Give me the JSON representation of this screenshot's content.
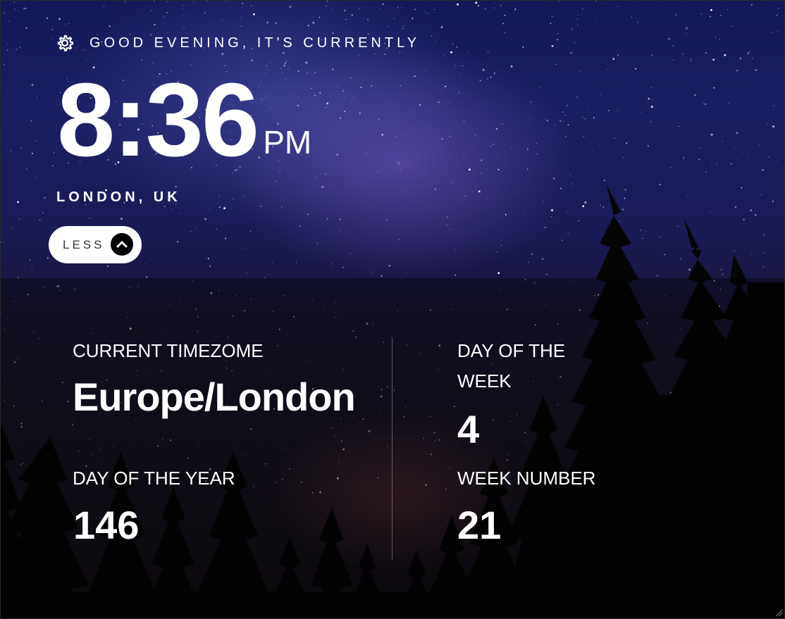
{
  "header": {
    "greeting": "GOOD EVENING, IT'S CURRENTLY",
    "settings_icon": "gear-icon"
  },
  "clock": {
    "time": "8:36",
    "period": "PM",
    "location": "LONDON, UK"
  },
  "toggle": {
    "label": "LESS",
    "icon": "chevron-up-icon"
  },
  "details": {
    "timezone": {
      "label": "CURRENT TIMEZOME",
      "value": "Europe/London"
    },
    "day_of_year": {
      "label": "DAY OF THE YEAR",
      "value": "146"
    },
    "day_of_week": {
      "label": "DAY OF THE WEEK",
      "value": "4"
    },
    "week_number": {
      "label": "WEEK NUMBER",
      "value": "21"
    }
  },
  "colors": {
    "text": "#ffffff",
    "button_bg": "#ffffff",
    "button_text": "#333333",
    "chevron_bg": "#000000"
  }
}
